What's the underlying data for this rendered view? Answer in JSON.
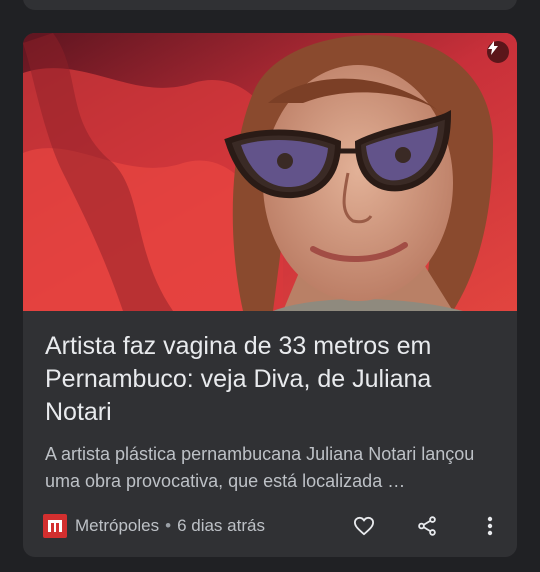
{
  "card": {
    "image_alt": "Juliana Notari portrait with red fabric",
    "title": "Artista faz vagina de 33 metros em Pernambuco: veja Diva, de Juliana Notari",
    "snippet": "A artista plástica pernambucana Juliana Notari lançou uma obra provocativa, que está localizada …",
    "source": "Metrópoles",
    "separator": "•",
    "age": "6 dias atrás",
    "logo_letter": "m"
  },
  "colors": {
    "background": "#202124",
    "card": "#303134",
    "title": "#e8eaed",
    "secondary_text": "#bdc1c6",
    "logo": "#d32f2f"
  },
  "icons": {
    "amp": "lightning-bolt-icon",
    "like": "heart-icon",
    "share": "share-icon",
    "menu": "more-vert-icon"
  }
}
